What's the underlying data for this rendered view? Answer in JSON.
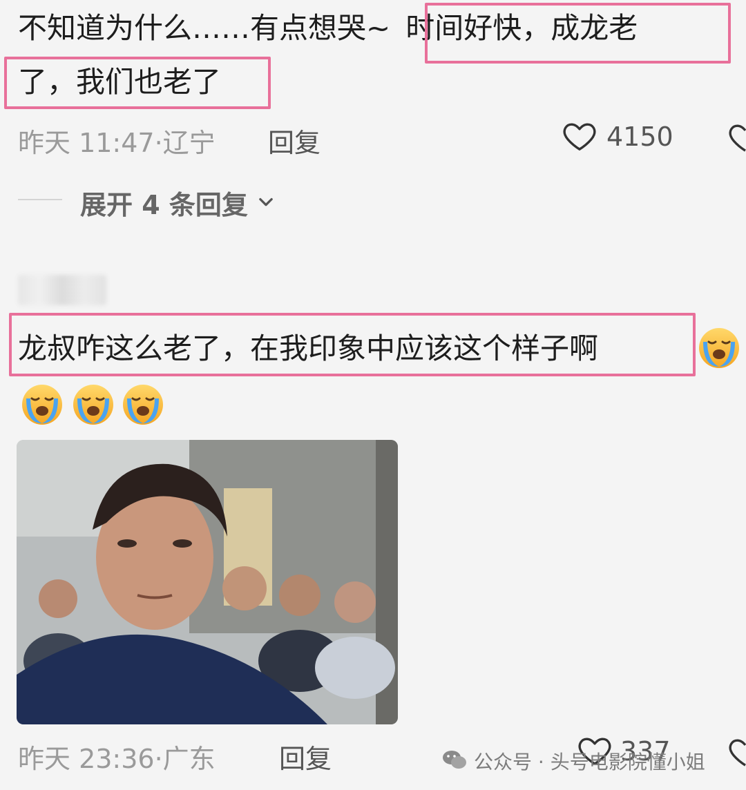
{
  "comment1": {
    "line1_a": "不知道为什么……有点想哭~",
    "line1_b": "时间好快，成龙老",
    "line2": "了，我们也老了",
    "time": "昨天 11:47·",
    "location": "辽宁",
    "reply": "回复",
    "likes": "4150",
    "expand_label": "展开 4 条回复"
  },
  "comment2": {
    "text_line1": "龙叔咋这么老了，在我印象中应该这个样子啊",
    "time": "昨天 23:36·",
    "location": "广东",
    "reply": "回复",
    "likes": "337"
  },
  "watermark": {
    "text": "公众号 · 头号电影院懂小姐"
  },
  "colors": {
    "highlight": "#e8709a",
    "background": "#f4f4f4"
  },
  "icons": [
    "heart-icon",
    "chevron-down-icon",
    "crying-emoji",
    "wechat-icon"
  ]
}
